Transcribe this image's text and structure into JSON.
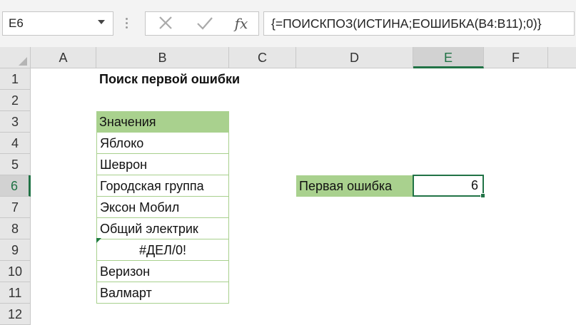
{
  "name_box": "E6",
  "formula_bar": {
    "formula": "{=ПОИСКПОЗ(ИСТИНА;ЕОШИБКА(B4:B11);0)}",
    "cancel_icon": "cross-icon",
    "enter_icon": "check-icon",
    "fx_label": "fx"
  },
  "columns": [
    "A",
    "B",
    "C",
    "D",
    "E",
    "F"
  ],
  "rows": [
    "1",
    "2",
    "3",
    "4",
    "5",
    "6",
    "7",
    "8",
    "9",
    "10",
    "11",
    "12"
  ],
  "selected_cell": {
    "column": "E",
    "row": "6"
  },
  "sheet": {
    "title": "Поиск первой ошибки",
    "list_header": "Значения",
    "values": [
      "Яблоко",
      "Шеврон",
      "Городская группа",
      "Эксон Мобил",
      "Общий электрик",
      "#ДЕЛ/0!",
      "Веризон",
      "Валмарт"
    ],
    "label": "Первая ошибка",
    "result": "6"
  },
  "colors": {
    "header_fill": "#a9d18e",
    "accent": "#217346"
  }
}
